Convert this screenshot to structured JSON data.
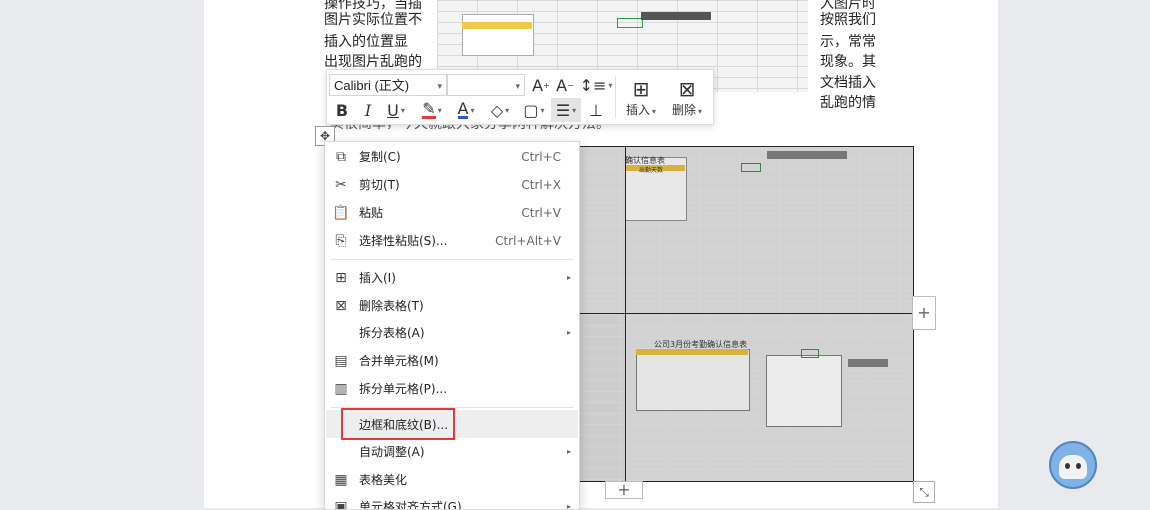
{
  "document": {
    "left_lines": [
      "操作技巧，当插",
      "图片实际位置不",
      "插入的位置显",
      "出现图片乱跑的"
    ],
    "right_lines": [
      "入图片时",
      "按照我们",
      "示，常常",
      "现象。其",
      "文档插入",
      "乱跑的情"
    ],
    "bottom_line": "实很简单，今天就跟大家分享两种解决方法。"
  },
  "toolbar": {
    "font_name": "Calibri (正文)",
    "font_size": "",
    "insert_label": "插入",
    "delete_label": "删除"
  },
  "context_menu": {
    "items": [
      {
        "label": "复制(C)",
        "shortcut": "Ctrl+C",
        "icon": "copy-icon"
      },
      {
        "label": "剪切(T)",
        "shortcut": "Ctrl+X",
        "icon": "scissors-icon"
      },
      {
        "label": "粘贴",
        "shortcut": "Ctrl+V",
        "icon": "paste-icon"
      },
      {
        "label": "选择性粘贴(S)...",
        "shortcut": "Ctrl+Alt+V",
        "icon": "paste-special-icon"
      },
      {
        "label": "插入(I)",
        "shortcut": "",
        "icon": "table-insert-icon"
      },
      {
        "label": "删除表格(T)",
        "shortcut": "",
        "icon": "table-delete-icon"
      },
      {
        "label": "拆分表格(A)",
        "shortcut": "",
        "icon": ""
      },
      {
        "label": "合并单元格(M)",
        "shortcut": "",
        "icon": "merge-cells-icon"
      },
      {
        "label": "拆分单元格(P)...",
        "shortcut": "",
        "icon": "split-cells-icon"
      },
      {
        "label": "边框和底纹(B)...",
        "shortcut": "",
        "icon": ""
      },
      {
        "label": "自动调整(A)",
        "shortcut": "",
        "icon": ""
      },
      {
        "label": "表格美化",
        "shortcut": "",
        "icon": "table-beautify-icon"
      },
      {
        "label": "单元格对齐方式(G)",
        "shortcut": "",
        "icon": "cell-align-icon"
      }
    ]
  },
  "embedded_image": {
    "sheet_title_top": "确认信息表",
    "sheet_header_top": "出勤天数",
    "sheet_title_bottom": "公司3月份考勤确认信息表"
  },
  "colors": {
    "highlight_border": "#e03b3b",
    "font_color_underline": "#e03b3b",
    "text_color_underline": "#2b57d1",
    "assistant_blue": "#7fb2e5"
  }
}
